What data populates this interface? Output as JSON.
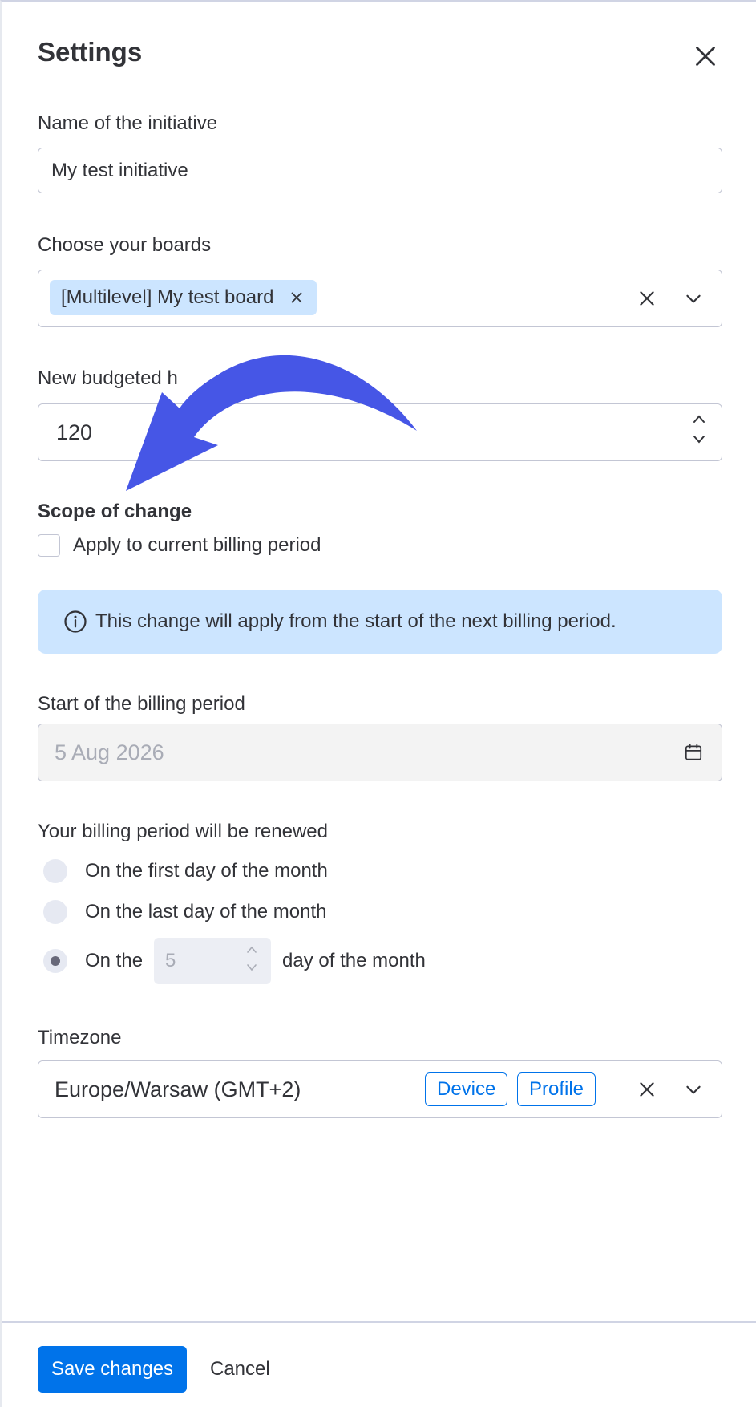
{
  "header": {
    "title": "Settings",
    "close_icon": "close-icon"
  },
  "initiative": {
    "label": "Name of the initiative",
    "value": "My test initiative"
  },
  "boards": {
    "label": "Choose your boards",
    "chip": "[Multilevel] My test board"
  },
  "budget": {
    "label": "New budgeted h",
    "value": "120"
  },
  "scope": {
    "title": "Scope of change",
    "checkbox_label": "Apply to current billing period",
    "checked": false
  },
  "info": {
    "text": "This change will apply from the start of the next billing period.",
    "icon": "info-icon"
  },
  "billing_start": {
    "label": "Start of the billing period",
    "value": "5 Aug 2026",
    "icon": "calendar-icon"
  },
  "renewal": {
    "label": "Your billing period will be renewed",
    "option_first": "On the first day of the month",
    "option_last": "On the last day of the month",
    "option_custom_prefix": "On the",
    "option_custom_day": "5",
    "option_custom_suffix": "day of the month",
    "selected": "custom"
  },
  "timezone": {
    "label": "Timezone",
    "value": "Europe/Warsaw (GMT+2)",
    "tag_device": "Device",
    "tag_profile": "Profile"
  },
  "footer": {
    "save_label": "Save changes",
    "cancel_label": "Cancel"
  },
  "colors": {
    "primary": "#0073ea",
    "info_bg": "#cce5ff",
    "annotation_arrow": "#4656e6"
  }
}
